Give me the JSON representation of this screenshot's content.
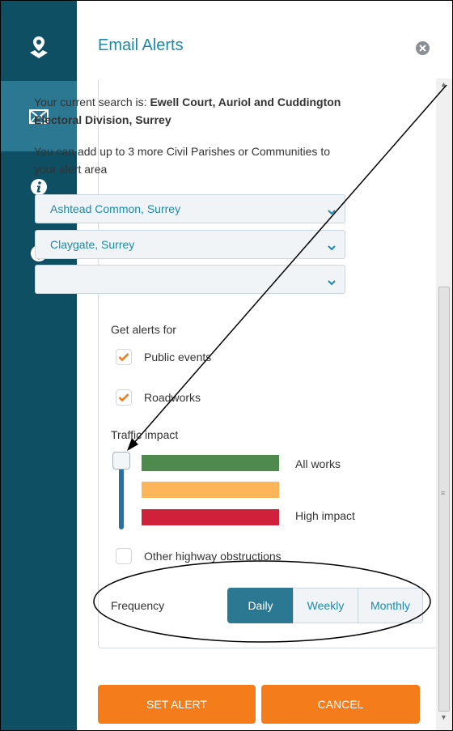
{
  "panel": {
    "title": "Email Alerts"
  },
  "sidebar": {
    "items": [
      {
        "icon": "map-marker-icon"
      },
      {
        "icon": "envelope-icon",
        "active": true
      },
      {
        "icon": "info-icon"
      },
      {
        "icon": "help-icon"
      }
    ]
  },
  "search": {
    "prefix": "Your current search is: ",
    "value": "Ewell Court, Auriol and Cuddington Electoral Division, Surrey"
  },
  "add_text": "You can add up to 3 more Civil Parishes or Communities to your alert area",
  "dropdowns": [
    {
      "value": "Ashtead Common, Surrey"
    },
    {
      "value": "Claygate, Surrey"
    },
    {
      "value": ""
    }
  ],
  "alerts": {
    "heading": "Get alerts for",
    "public_events": {
      "label": "Public events",
      "checked": true
    },
    "roadworks": {
      "label": "Roadworks",
      "checked": true
    }
  },
  "traffic": {
    "heading": "Traffic impact",
    "levels": [
      {
        "label": "All works",
        "color": "#4e8a4e"
      },
      {
        "label": "",
        "color": "#fdb55a"
      },
      {
        "label": "High impact",
        "color": "#d0213a"
      }
    ]
  },
  "obstructions": {
    "label": "Other highway obstructions",
    "checked": false
  },
  "frequency": {
    "label": "Frequency",
    "options": [
      "Daily",
      "Weekly",
      "Monthly"
    ],
    "selected": "Daily"
  },
  "buttons": {
    "set_alert": "SET ALERT",
    "cancel": "CANCEL"
  },
  "colors": {
    "sidebar": "#0f4f63",
    "sidebar_active": "#2b7893",
    "accent": "#1b8aa8",
    "button": "#f47c1b",
    "check": "#f47c1b"
  }
}
